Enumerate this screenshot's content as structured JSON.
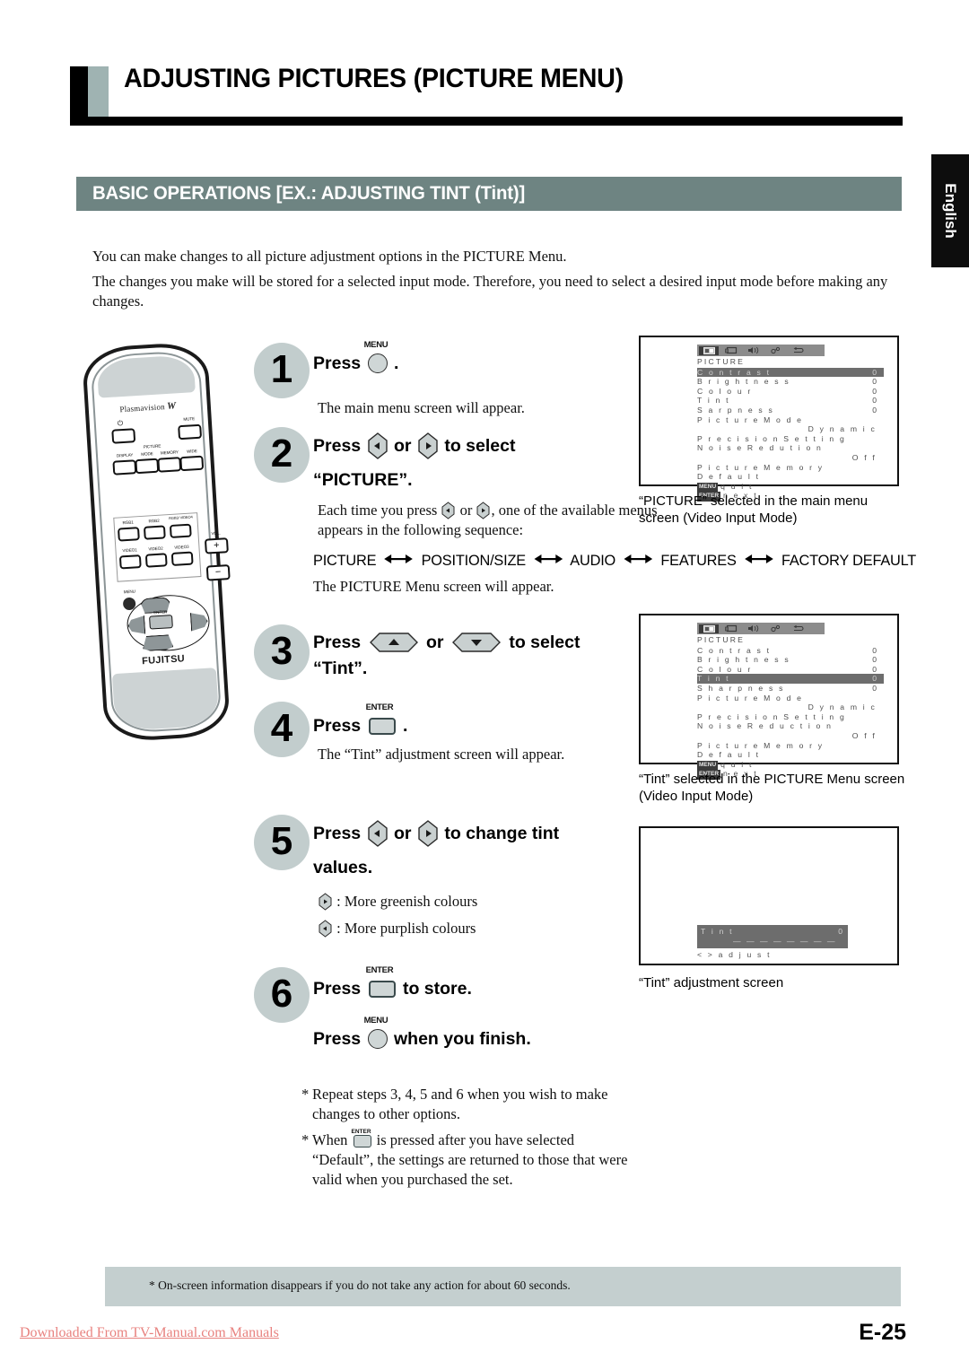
{
  "page": {
    "title": "ADJUSTING PICTURES (PICTURE MENU)",
    "section_title": "BASIC OPERATIONS [EX.: ADJUSTING TINT (Tint)]",
    "side_tab": "English",
    "page_number": "E-25",
    "accent_color": "#6e8482",
    "notice_bg_color": "#c4cfcf",
    "badge_color": "#c2cdcd"
  },
  "intro": {
    "line1": "You can make changes to all picture adjustment options in the PICTURE Menu.",
    "line2": "The changes you make will be stored for a selected input mode.  Therefore, you need to select a desired input mode before making any changes."
  },
  "remote": {
    "brand_top": "Plasmavision",
    "brand_top_italic": "W",
    "brand_bottom": "FUJITSU",
    "power_icon": "power-icon",
    "keys": {
      "mute": "MUTE",
      "display": "DISPLAY",
      "picture_group": "PICTURE",
      "mode": "MODE",
      "memory": "MEMORY",
      "wide": "WIDE",
      "rgb1": "RGB1",
      "rgb2": "RGB2",
      "rgb3_video4": "RGB3/ VIDEO4",
      "video1": "VIDEO1",
      "video2": "VIDEO2",
      "video3": "VIDEO3",
      "vol": "VOL.",
      "vol_plus": "+",
      "vol_minus": "−",
      "menu": "MENU",
      "enter": "ENTER"
    }
  },
  "steps": [
    {
      "number": "1",
      "head_pre": "Press",
      "key": "MENU",
      "head_post": ".",
      "note": "The main menu screen will appear."
    },
    {
      "number": "2",
      "head_pre": "Press",
      "head_mid": "or",
      "head_post": "to select",
      "head_line2": "“PICTURE”.",
      "note_pre": "Each time you press",
      "note_mid": "or",
      "note_post": ", one of the available menus appears in the following sequence:",
      "note_after_sequence": "The PICTURE Menu screen will appear."
    },
    {
      "number": "3",
      "head_pre": "Press",
      "head_mid": "or",
      "head_post": "to select",
      "head_line2": "“Tint”."
    },
    {
      "number": "4",
      "head_pre": "Press",
      "key": "ENTER",
      "head_post": ".",
      "note": "The “Tint” adjustment screen will appear."
    },
    {
      "number": "5",
      "head_pre": "Press",
      "head_mid": "or",
      "head_post": "to change tint",
      "head_line2": "values.",
      "hint_right": ": More greenish colours",
      "hint_left": ": More purplish colours"
    },
    {
      "number": "6",
      "head_pre": "Press",
      "key": "ENTER",
      "head_post": "to store.",
      "head2_pre": "Press",
      "key2": "MENU",
      "head2_post": "when you finish."
    }
  ],
  "menu_sequence": {
    "items": [
      "PICTURE",
      "POSITION/SIZE",
      "AUDIO",
      "FEATURES",
      "FACTORY DEFAULT"
    ],
    "separator": "◀—▶"
  },
  "osd": {
    "icons": [
      "picture-icon",
      "position-size-icon",
      "audio-icon",
      "features-icon",
      "factory-default-icon"
    ],
    "screen1": {
      "title": "PICTURE",
      "rows": [
        {
          "label": "C o n t r a s t",
          "value": "0",
          "highlight": true
        },
        {
          "label": "B r i g h t n e s s",
          "value": "0",
          "highlight": false
        },
        {
          "label": "C o l o u r",
          "value": "0",
          "highlight": false
        },
        {
          "label": "T i n t",
          "value": "0",
          "highlight": false
        },
        {
          "label": "S a r p n e s s",
          "value": "0",
          "highlight": false
        }
      ],
      "picture_mode_label": "P i c t u r e   M o d e",
      "picture_mode_value": "D y n a m i c",
      "precision_setting": "P r e c i s i o n S e t t i n g",
      "noise_reduction_label": "N o i s e   R e d u t i o n",
      "noise_reduction_value": "O f f",
      "picture_memory": "P i c t u r e   M e m o r y",
      "default": "D e f a u l t",
      "quit_tag": "MENU",
      "quit_label": "q u i t",
      "next_tag": "ENTER",
      "next_label": "n e x t",
      "caption": "“PICTURE” selected in the main menu screen (Video Input Mode)"
    },
    "screen2": {
      "title": "PICTURE",
      "rows": [
        {
          "label": "C o n t r a s t",
          "value": "0",
          "highlight": false
        },
        {
          "label": "B r i g h t n e s s",
          "value": "0",
          "highlight": false
        },
        {
          "label": "C o l o u r",
          "value": "0",
          "highlight": false
        },
        {
          "label": "T i n t",
          "value": "0",
          "highlight": true
        },
        {
          "label": "S h a r p n e s s",
          "value": "0",
          "highlight": false
        }
      ],
      "picture_mode_label": "P i c t u r e   M o d e",
      "picture_mode_value": "D y n a m i c",
      "precision_setting": "P r e c i s i o n S e t t i n g",
      "noise_reduction_label": "N o i s e   R e d u c t i o n",
      "noise_reduction_value": "O f f",
      "picture_memory": "P i c t u r e   M e m o r y",
      "default": "D e f a u l t",
      "quit_tag": "MENU",
      "quit_label": "q u i t",
      "next_tag": "ENTER",
      "next_label": "n e x t",
      "caption": "“Tint” selected in the PICTURE Menu screen (Video Input Mode)"
    },
    "screen3": {
      "bar_label": "T i n t",
      "bar_value": "0",
      "bar_gauge": "— — — — — — — —",
      "hint": "< >   a d j u s t",
      "caption": "“Tint” adjustment screen"
    }
  },
  "footnotes": {
    "star": "*",
    "note1": "Repeat steps 3, 4, 5 and 6 when you wish to make changes to other options.",
    "note2_pre": "When",
    "note2_post": "is pressed after you have selected “Default”, the settings are returned to those that were valid when you purchased the set.",
    "bottom_notice": "* On-screen information disappears if you do not take any action for about 60 seconds."
  },
  "footer": {
    "download_link": "Downloaded From TV-Manual.com Manuals"
  }
}
